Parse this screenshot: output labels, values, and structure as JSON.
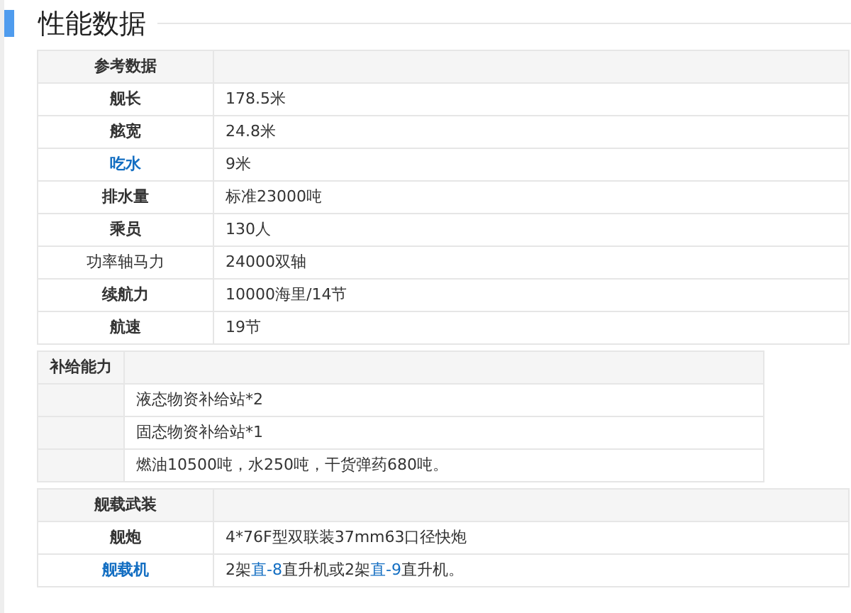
{
  "heading": "性能数据",
  "tables": [
    {
      "header": "参考数据",
      "rows": [
        {
          "label": {
            "text": "舰长",
            "kind": "bold"
          },
          "value": [
            {
              "text": "178.5米",
              "link": false
            }
          ]
        },
        {
          "label": {
            "text": "舷宽",
            "kind": "bold"
          },
          "value": [
            {
              "text": "24.8米",
              "link": false
            }
          ]
        },
        {
          "label": {
            "text": "吃水",
            "kind": "link"
          },
          "value": [
            {
              "text": "9米",
              "link": false
            }
          ]
        },
        {
          "label": {
            "text": "排水量",
            "kind": "bold"
          },
          "value": [
            {
              "text": "标准23000吨",
              "link": false
            }
          ]
        },
        {
          "label": {
            "text": "乘员",
            "kind": "bold"
          },
          "value": [
            {
              "text": "130人",
              "link": false
            }
          ]
        },
        {
          "label": {
            "text": "功率轴马力",
            "kind": "normal"
          },
          "value": [
            {
              "text": "24000双轴",
              "link": false
            }
          ]
        },
        {
          "label": {
            "text": "续航力",
            "kind": "bold"
          },
          "value": [
            {
              "text": "10000海里/14节",
              "link": false
            }
          ]
        },
        {
          "label": {
            "text": "航速",
            "kind": "bold"
          },
          "value": [
            {
              "text": "19节",
              "link": false
            }
          ]
        }
      ]
    },
    {
      "header": "补给能力",
      "rows": [
        {
          "value": [
            {
              "text": "液态物资补给站*2",
              "link": false
            }
          ]
        },
        {
          "value": [
            {
              "text": "固态物资补给站*1",
              "link": false
            }
          ]
        },
        {
          "value": [
            {
              "text": "燃油10500吨，水250吨，干货弹药680吨。",
              "link": false
            }
          ]
        }
      ]
    },
    {
      "header": "舰载武装",
      "rows": [
        {
          "label": {
            "text": "舰炮",
            "kind": "bold"
          },
          "value": [
            {
              "text": "4*76F型双联装37mm63口径快炮",
              "link": false
            }
          ]
        },
        {
          "label": {
            "text": "舰载机",
            "kind": "link"
          },
          "value": [
            {
              "text": "2架",
              "link": false
            },
            {
              "text": "直-8",
              "link": true
            },
            {
              "text": "直升机或2架",
              "link": false
            },
            {
              "text": "直-9",
              "link": true
            },
            {
              "text": "直升机。",
              "link": false
            }
          ]
        }
      ]
    }
  ]
}
